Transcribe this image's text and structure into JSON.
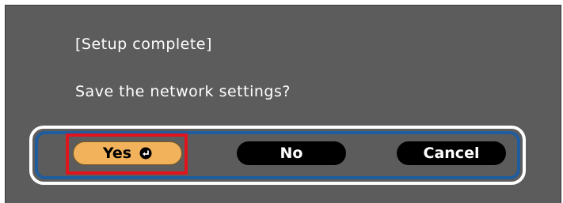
{
  "dialog": {
    "title": "[Setup complete]",
    "question": "Save the network settings?"
  },
  "buttons": {
    "yes_label": "Yes",
    "no_label": "No",
    "cancel_label": "Cancel",
    "selected": "Yes"
  },
  "icons": {
    "enter": "enter-icon"
  },
  "colors": {
    "background": "#5c5c5c",
    "selected_button": "#f2b25c",
    "button": "#000000",
    "group_border": "#1f5d9e",
    "highlight": "#e0141c"
  }
}
